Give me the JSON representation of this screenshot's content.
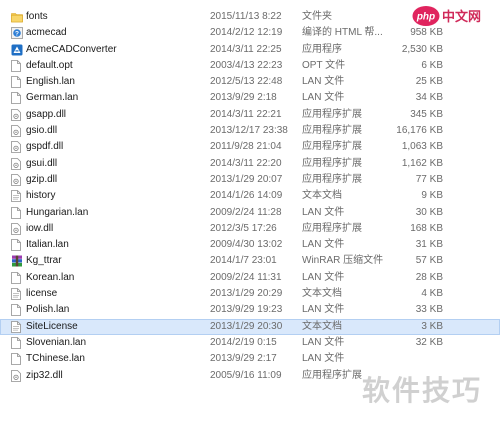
{
  "files": [
    {
      "name": "fonts",
      "date": "2015/11/13 8:22",
      "type": "文件夹",
      "size": "",
      "icon": "folder-icon"
    },
    {
      "name": "acmecad",
      "date": "2014/2/12 12:19",
      "type": "编译的 HTML 帮...",
      "size": "958 KB",
      "icon": "help-file-icon"
    },
    {
      "name": "AcmeCADConverter",
      "date": "2014/3/11 22:25",
      "type": "应用程序",
      "size": "2,530 KB",
      "icon": "app-icon"
    },
    {
      "name": "default.opt",
      "date": "2003/4/13 22:23",
      "type": "OPT 文件",
      "size": "6 KB",
      "icon": "file-icon"
    },
    {
      "name": "English.lan",
      "date": "2012/5/13 22:48",
      "type": "LAN 文件",
      "size": "25 KB",
      "icon": "file-icon"
    },
    {
      "name": "German.lan",
      "date": "2013/9/29 2:18",
      "type": "LAN 文件",
      "size": "34 KB",
      "icon": "file-icon"
    },
    {
      "name": "gsapp.dll",
      "date": "2014/3/11 22:21",
      "type": "应用程序扩展",
      "size": "345 KB",
      "icon": "dll-icon"
    },
    {
      "name": "gsio.dll",
      "date": "2013/12/17 23:38",
      "type": "应用程序扩展",
      "size": "16,176 KB",
      "icon": "dll-icon"
    },
    {
      "name": "gspdf.dll",
      "date": "2011/9/28 21:04",
      "type": "应用程序扩展",
      "size": "1,063 KB",
      "icon": "dll-icon"
    },
    {
      "name": "gsui.dll",
      "date": "2014/3/11 22:20",
      "type": "应用程序扩展",
      "size": "1,162 KB",
      "icon": "dll-icon"
    },
    {
      "name": "gzip.dll",
      "date": "2013/1/29 20:07",
      "type": "应用程序扩展",
      "size": "77 KB",
      "icon": "dll-icon"
    },
    {
      "name": "history",
      "date": "2014/1/26 14:09",
      "type": "文本文档",
      "size": "9 KB",
      "icon": "text-file-icon"
    },
    {
      "name": "Hungarian.lan",
      "date": "2009/2/24 11:28",
      "type": "LAN 文件",
      "size": "30 KB",
      "icon": "file-icon"
    },
    {
      "name": "iow.dll",
      "date": "2012/3/5 17:26",
      "type": "应用程序扩展",
      "size": "168 KB",
      "icon": "dll-icon"
    },
    {
      "name": "Italian.lan",
      "date": "2009/4/30 13:02",
      "type": "LAN 文件",
      "size": "31 KB",
      "icon": "file-icon"
    },
    {
      "name": "Kg_ttrar",
      "date": "2014/1/7 23:01",
      "type": "WinRAR 压缩文件",
      "size": "57 KB",
      "icon": "archive-icon"
    },
    {
      "name": "Korean.lan",
      "date": "2009/2/24 11:31",
      "type": "LAN 文件",
      "size": "28 KB",
      "icon": "file-icon"
    },
    {
      "name": "license",
      "date": "2013/1/29 20:29",
      "type": "文本文档",
      "size": "4 KB",
      "icon": "text-file-icon"
    },
    {
      "name": "Polish.lan",
      "date": "2013/9/29 19:23",
      "type": "LAN 文件",
      "size": "33 KB",
      "icon": "file-icon"
    },
    {
      "name": "SiteLicense",
      "date": "2013/1/29 20:30",
      "type": "文本文档",
      "size": "3 KB",
      "icon": "text-file-icon",
      "selected": true
    },
    {
      "name": "Slovenian.lan",
      "date": "2014/2/19 0:15",
      "type": "LAN 文件",
      "size": "32 KB",
      "icon": "file-icon"
    },
    {
      "name": "TChinese.lan",
      "date": "2013/9/29 2:17",
      "type": "LAN 文件",
      "size": "",
      "icon": "file-icon"
    },
    {
      "name": "zip32.dll",
      "date": "2005/9/16 11:09",
      "type": "应用程序扩展",
      "size": "",
      "icon": "dll-icon"
    }
  ],
  "logo": {
    "php": "php",
    "cn": "中文网"
  },
  "watermark": "软件技巧"
}
